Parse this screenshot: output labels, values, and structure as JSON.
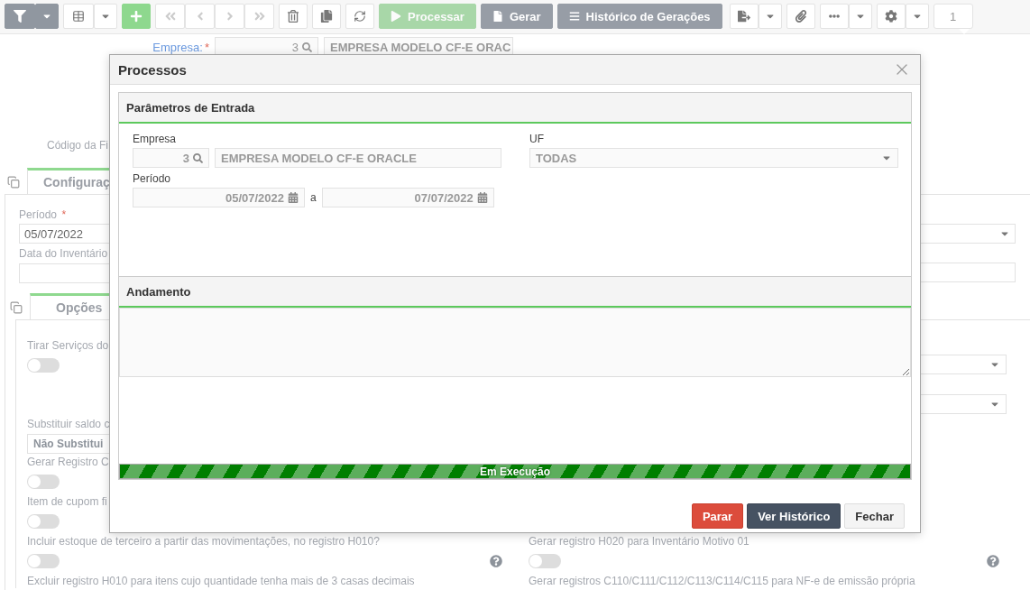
{
  "toolbar": {
    "actions": [
      {
        "label": "Processar",
        "disabled": true
      },
      {
        "label": "Gerar",
        "disabled": false
      },
      {
        "label": "Histórico de Gerações",
        "disabled": false
      }
    ],
    "page_indicator": "1"
  },
  "header_form": {
    "company": {
      "label": "Empresa:",
      "required_mark": "*",
      "code": "3",
      "name": "EMPRESA MODELO CF-E ORAC"
    },
    "branch_label": "Código da Fi"
  },
  "config_tab": {
    "label": "Configuraç",
    "selected": true
  },
  "config_fields": {
    "period": {
      "label": "Período",
      "required_mark": "*",
      "value": "05/07/2022"
    },
    "inventory_date": {
      "label": "Data do Inventário"
    }
  },
  "options_tab": {
    "label": "Opções",
    "selected": true
  },
  "options_left": [
    {
      "kind": "toggle",
      "label": "Tirar Serviços do",
      "on": false
    },
    {
      "kind": "select",
      "label": "Substituir saldo c",
      "value": "Não Substitui"
    },
    {
      "kind": "toggle",
      "label": "Gerar Registro C",
      "on": false
    },
    {
      "kind": "toggle",
      "label": "Item de cupom fi",
      "on": false
    },
    {
      "kind": "toggle",
      "label": "Incluir estoque de terceiro a partir das movimentações, no registro H010?",
      "on": false,
      "help": true
    },
    {
      "kind": "text",
      "label": "Excluir registro H010 para itens cujo quantidade tenha mais de 3 casas decimais"
    }
  ],
  "options_right": [
    {
      "kind": "select"
    },
    {
      "kind": "select"
    },
    {
      "kind": "toggle",
      "label": "Gerar registro H020 para Inventário Motivo 01",
      "on": false,
      "help": true
    },
    {
      "kind": "text",
      "label": "Gerar registros C110/C111/C112/C113/C114/C115 para NF-e de emissão própria"
    }
  ],
  "dialog": {
    "title": "Processos",
    "input_panel": {
      "title": "Parâmetros de Entrada",
      "company": {
        "label": "Empresa",
        "code": "3",
        "name": "EMPRESA MODELO CF-E ORACLE"
      },
      "uf": {
        "label": "UF",
        "value": "TODAS"
      },
      "period": {
        "label": "Período",
        "start": "05/07/2022",
        "separator": "a",
        "end": "07/07/2022"
      }
    },
    "progress_panel": {
      "title": "Andamento",
      "progress": {
        "label": "Em Execução",
        "level": 1
      }
    },
    "buttons": [
      {
        "label": "Parar",
        "kind": "danger"
      },
      {
        "label": "Ver Histórico",
        "kind": "primary"
      },
      {
        "label": "Fechar",
        "kind": "default"
      }
    ]
  }
}
